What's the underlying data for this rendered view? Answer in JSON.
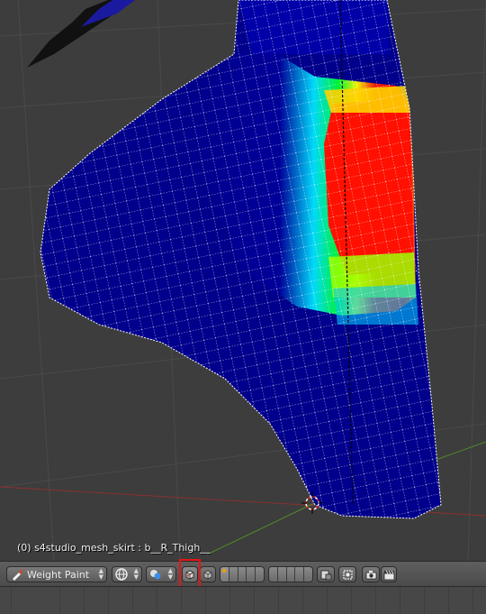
{
  "viewport": {
    "object_label": "(0) s4studio_mesh_skirt : b__R_Thigh__",
    "background_color": "#3d3d3d",
    "weight_colors": [
      "#00008b",
      "#0000ff",
      "#00ffff",
      "#00ff00",
      "#ffff00",
      "#ff0000"
    ]
  },
  "header": {
    "mode_label": "Weight Paint",
    "mode_icon": "weight-paint-icon",
    "viewport_shading_icon": "globe-icon",
    "pivot_icon": "pivot-point-icon",
    "face_mask_icon": "face-mask-icon",
    "vertex_mask_icon": "vertex-mask-icon",
    "layers_icon": "layers-icon",
    "render_icon": "camera-icon",
    "anim_render_icon": "clapperboard-icon"
  }
}
